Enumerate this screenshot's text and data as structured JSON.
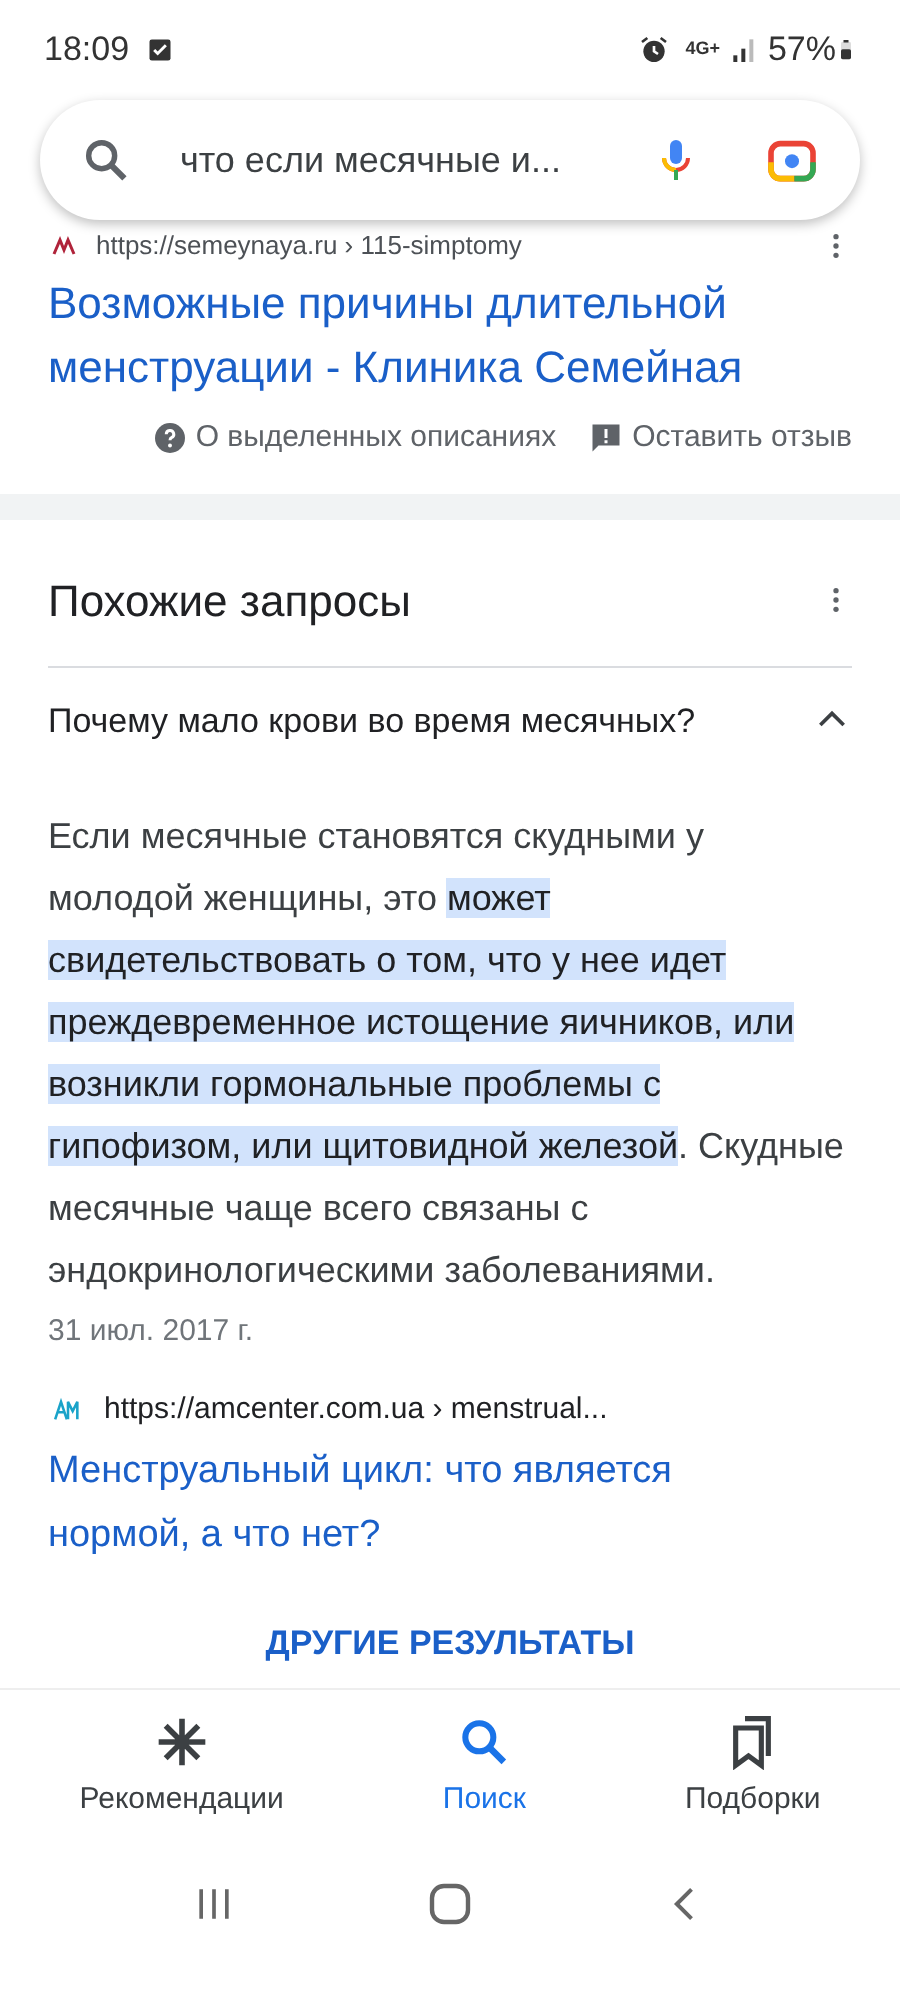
{
  "status_bar": {
    "time": "18:09",
    "network": "4G+",
    "battery": "57%"
  },
  "search": {
    "query": "что если месячные и..."
  },
  "result_top": {
    "url": "https://semeynaya.ru › 115-simptomy",
    "title": "Возможные причины длительной менструации - Клиника Семейная",
    "about_link": "О выделенных описаниях",
    "feedback_link": "Оставить отзыв"
  },
  "related": {
    "heading": "Похожие запросы",
    "questions": [
      {
        "text": "Почему мало крови во время месячных?",
        "expanded": true,
        "answer": "Если месячные становятся скудными у молодой женщины, это **может свидетельствовать о том, что у нее идет преждевременное истощение яичников, или возникли гормональные проблемы с гипофизом, или щитовидной железой**. Скудные месячные чаще всего связаны с эндокринологическими заболеваниями.",
        "date": "31 июл. 2017 г.",
        "source_url": "https://amcenter.com.ua › menstrual...",
        "source_title": "Менструальный цикл: что является нормой, а что нет?"
      }
    ]
  },
  "more_button": "ДРУГИЕ РЕЗУЛЬТАТЫ",
  "bottom_nav": [
    {
      "label": "Рекомендации",
      "selected": false
    },
    {
      "label": "Поиск",
      "selected": true
    },
    {
      "label": "Подборки",
      "selected": false
    }
  ]
}
